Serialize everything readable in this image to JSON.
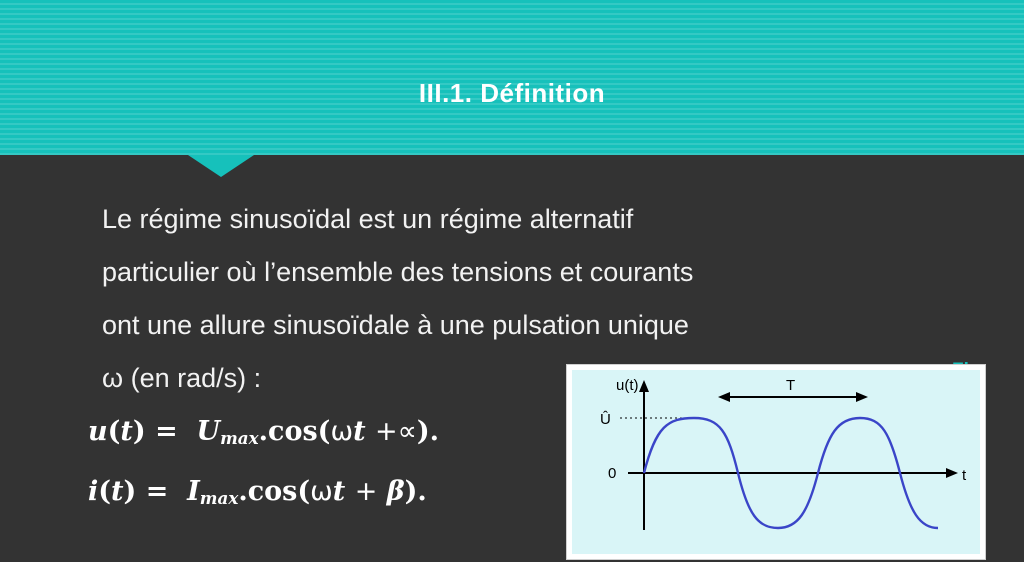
{
  "slide": {
    "header": {
      "title": "III.1. Définition",
      "band_color": "#16c1bb",
      "title_color": "#ffffff"
    },
    "background_color": "#333333",
    "body": {
      "paragraphs": [
        "Le régime sinusoïdal est un régime alternatif",
        "particulier où l’ensemble des tensions et courants",
        "ont une allure sinusoïdale à une pulsation unique",
        "ω (en rad/s) :"
      ],
      "text_color": "#f2f2f2"
    },
    "formulas": [
      {
        "lhs_fn": "u",
        "lhs_var": "t",
        "equals": "=",
        "amplitude": "U",
        "amplitude_sub": "max",
        "dot": ".",
        "cos": "cos(",
        "omega": "ω",
        "time": "t",
        "plus": "+",
        "phase": "∝",
        "close": ")."
      },
      {
        "lhs_fn": "i",
        "lhs_var": "t",
        "equals": "=",
        "amplitude": "I",
        "amplitude_sub": "max",
        "dot": ".",
        "cos": "cos(",
        "omega": "ω",
        "time": "t",
        "plus": "+",
        "phase": "β",
        "close": ")."
      }
    ],
    "figure": {
      "caption": "Fig",
      "caption_color": "#16c1bb",
      "background_color": "#d9f5f7",
      "curve_color": "#3a45c8",
      "axis_color": "#000000",
      "labels": {
        "y_axis": "u(t)",
        "amplitude": "Û",
        "origin": "0",
        "x_axis": "t",
        "period": "T"
      }
    }
  }
}
